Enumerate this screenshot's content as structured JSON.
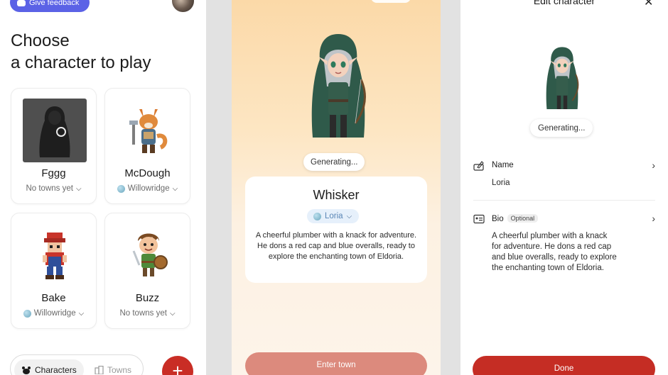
{
  "left_screen": {
    "feedback_button": "Give feedback",
    "title_line1": "Choose",
    "title_line2": "a character to play",
    "cards": [
      {
        "name": "Fggg",
        "town": "No towns yet",
        "has_globe": false
      },
      {
        "name": "McDough",
        "town": "Willowridge",
        "has_globe": true
      },
      {
        "name": "Bake",
        "town": "Willowridge",
        "has_globe": true
      },
      {
        "name": "Buzz",
        "town": "No towns yet",
        "has_globe": false
      }
    ],
    "tabs": {
      "active": "Characters",
      "inactive": "Towns"
    },
    "fab_label": "+"
  },
  "middle_screen": {
    "generating": "Generating...",
    "character_name": "Whisker",
    "town": "Loria",
    "bio": "A cheerful plumber with a knack for adventure. He dons a red cap and blue overalls, ready to explore the enchanting town of Eldoria.",
    "enter_button": "Enter town"
  },
  "right_screen": {
    "title": "Edit character",
    "generating": "Generating...",
    "name_label": "Name",
    "name_value": "Loria",
    "bio_label": "Bio",
    "bio_badge": "Optional",
    "bio_value_lines": [
      "A cheerful plumber with a knack",
      "for adventure. He dons a red cap",
      "and blue overalls, ready to explore",
      "the enchanting town of Eldoria."
    ],
    "done_button": "Done"
  },
  "colors": {
    "accent_red": "#c92d25",
    "feedback_blue": "#5b62e6",
    "enter_button": "#dc8a7d",
    "town_pill_bg": "#e6f0fb"
  },
  "icons": [
    "discord-icon",
    "avatar",
    "loading-ring-icon",
    "globe-icon",
    "chevron-down-icon",
    "paw-icon",
    "town-icon",
    "plus-icon",
    "close-icon",
    "edit-name-icon",
    "bio-card-icon",
    "chevron-right-icon"
  ]
}
